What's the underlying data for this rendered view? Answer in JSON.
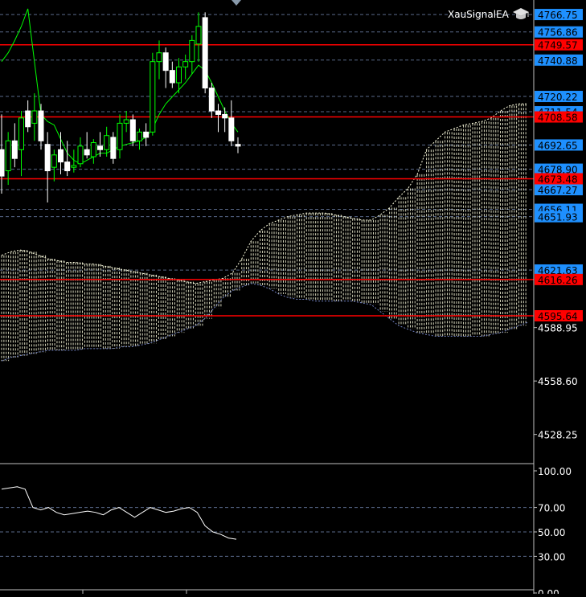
{
  "expert": {
    "name": "XauSignalEA",
    "icon": "graduation-cap-icon"
  },
  "colors": {
    "background": "#000000",
    "bull": "#00ff00",
    "bear": "#ffffff",
    "grid": "#5a6a8a",
    "red_level": "#ff0000",
    "blue_tag": "#1e90ff",
    "cloud_bull": "#ffffe0",
    "cloud_bear": "#ff6060",
    "ma_line": "#00ff00",
    "rsi_line": "#ffffff"
  },
  "price_axis": {
    "min": 4520.0,
    "max": 4770.0,
    "plain_ticks": [
      "4588.95",
      "4558.60",
      "4528.25"
    ],
    "blue_tags": [
      "4766.75",
      "4756.86",
      "4740.88",
      "4720.22",
      "4711.54",
      "4692.65",
      "4678.90",
      "4667.27",
      "4656.11",
      "4651.93",
      "4621.63"
    ],
    "red_tags": [
      "4749.57",
      "4708.58",
      "4673.48",
      "4616.26",
      "4595.64"
    ]
  },
  "rsi_axis": {
    "min": 0,
    "max": 100,
    "ticks": [
      "100.00",
      "70.00",
      "50.00",
      "30.00",
      "0.00"
    ]
  },
  "chart_data": {
    "type": "candlestick",
    "title": "",
    "candles": [
      {
        "o": 4690,
        "h": 4710,
        "l": 4665,
        "c": 4675
      },
      {
        "o": 4678,
        "h": 4700,
        "l": 4670,
        "c": 4695
      },
      {
        "o": 4695,
        "h": 4705,
        "l": 4680,
        "c": 4685
      },
      {
        "o": 4690,
        "h": 4712,
        "l": 4675,
        "c": 4708
      },
      {
        "o": 4712,
        "h": 4718,
        "l": 4700,
        "c": 4703
      },
      {
        "o": 4705,
        "h": 4722,
        "l": 4695,
        "c": 4712
      },
      {
        "o": 4712,
        "h": 4716,
        "l": 4690,
        "c": 4695
      },
      {
        "o": 4693,
        "h": 4700,
        "l": 4660,
        "c": 4678
      },
      {
        "o": 4680,
        "h": 4690,
        "l": 4672,
        "c": 4687
      },
      {
        "o": 4690,
        "h": 4700,
        "l": 4676,
        "c": 4683
      },
      {
        "o": 4683,
        "h": 4695,
        "l": 4675,
        "c": 4678
      },
      {
        "o": 4680,
        "h": 4690,
        "l": 4677,
        "c": 4681
      },
      {
        "o": 4682,
        "h": 4697,
        "l": 4680,
        "c": 4692
      },
      {
        "o": 4690,
        "h": 4700,
        "l": 4685,
        "c": 4687
      },
      {
        "o": 4686,
        "h": 4696,
        "l": 4682,
        "c": 4694
      },
      {
        "o": 4692,
        "h": 4700,
        "l": 4686,
        "c": 4690
      },
      {
        "o": 4690,
        "h": 4703,
        "l": 4686,
        "c": 4698
      },
      {
        "o": 4697,
        "h": 4700,
        "l": 4682,
        "c": 4685
      },
      {
        "o": 4690,
        "h": 4710,
        "l": 4685,
        "c": 4705
      },
      {
        "o": 4705,
        "h": 4712,
        "l": 4700,
        "c": 4707
      },
      {
        "o": 4707,
        "h": 4710,
        "l": 4692,
        "c": 4695
      },
      {
        "o": 4695,
        "h": 4702,
        "l": 4690,
        "c": 4700
      },
      {
        "o": 4700,
        "h": 4705,
        "l": 4692,
        "c": 4697
      },
      {
        "o": 4700,
        "h": 4745,
        "l": 4698,
        "c": 4740
      },
      {
        "o": 4740,
        "h": 4752,
        "l": 4730,
        "c": 4745
      },
      {
        "o": 4745,
        "h": 4748,
        "l": 4725,
        "c": 4735
      },
      {
        "o": 4735,
        "h": 4740,
        "l": 4725,
        "c": 4728
      },
      {
        "o": 4728,
        "h": 4742,
        "l": 4722,
        "c": 4737
      },
      {
        "o": 4737,
        "h": 4744,
        "l": 4730,
        "c": 4740
      },
      {
        "o": 4740,
        "h": 4755,
        "l": 4733,
        "c": 4752
      },
      {
        "o": 4750,
        "h": 4768,
        "l": 4740,
        "c": 4760
      },
      {
        "o": 4765,
        "h": 4768,
        "l": 4722,
        "c": 4725
      },
      {
        "o": 4725,
        "h": 4728,
        "l": 4708,
        "c": 4712
      },
      {
        "o": 4712,
        "h": 4716,
        "l": 4700,
        "c": 4710
      },
      {
        "o": 4710,
        "h": 4714,
        "l": 4700,
        "c": 4708
      },
      {
        "o": 4708,
        "h": 4718,
        "l": 4692,
        "c": 4695
      },
      {
        "o": 4693,
        "h": 4697,
        "l": 4688,
        "c": 4692
      }
    ],
    "ma_line": [
      4740,
      4745,
      4752,
      4760,
      4770,
      4740,
      4710,
      4706,
      4704,
      4696,
      4688,
      4684,
      4682,
      4684,
      4686,
      4688,
      4688,
      4690,
      4692,
      4693,
      4694,
      4695,
      4697,
      4702,
      4710,
      4716,
      4720,
      4724,
      4728,
      4733,
      4738,
      4735,
      4728,
      4720,
      4712,
      4705,
      4700
    ],
    "cloud_span_a": [
      4630,
      4632,
      4633,
      4632,
      4630,
      4628,
      4627,
      4626,
      4626,
      4625,
      4625,
      4624,
      4623,
      4622,
      4621,
      4620,
      4619,
      4618,
      4617,
      4616,
      4615,
      4614,
      4615,
      4616,
      4617,
      4620,
      4628,
      4638,
      4644,
      4648,
      4650,
      4652,
      4653,
      4654,
      4654,
      4654,
      4653,
      4652,
      4651,
      4650,
      4650,
      4653,
      4657,
      4663,
      4668,
      4676,
      4690,
      4695,
      4700,
      4702,
      4704,
      4705,
      4706,
      4708,
      4712,
      4715,
      4716,
      4716
    ],
    "cloud_span_b": [
      4570,
      4572,
      4573,
      4574,
      4575,
      4576,
      4576,
      4576,
      4576,
      4577,
      4577,
      4577,
      4577,
      4578,
      4578,
      4579,
      4580,
      4582,
      4584,
      4586,
      4588,
      4590,
      4594,
      4600,
      4606,
      4610,
      4612,
      4614,
      4613,
      4611,
      4608,
      4606,
      4605,
      4605,
      4604,
      4604,
      4604,
      4604,
      4604,
      4603,
      4602,
      4598,
      4594,
      4590,
      4588,
      4586,
      4585,
      4584,
      4584,
      4584,
      4584,
      4584,
      4584,
      4585,
      4586,
      4588,
      4590,
      4592
    ],
    "rsi": [
      85,
      86,
      87,
      85,
      70,
      68,
      70,
      66,
      64,
      65,
      66,
      67,
      66,
      64,
      68,
      70,
      66,
      62,
      66,
      70,
      68,
      66,
      67,
      69,
      70,
      66,
      55,
      50,
      48,
      45,
      44
    ]
  }
}
